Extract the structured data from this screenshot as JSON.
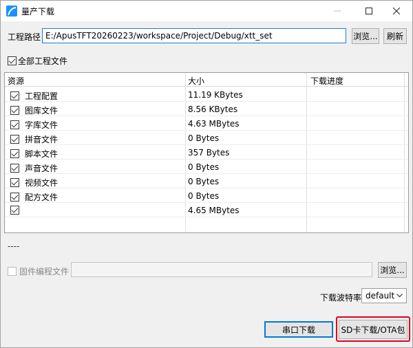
{
  "window": {
    "title": "量产下载",
    "icon": "app-logo-icon",
    "accent_color": "#1e90ff"
  },
  "project": {
    "label": "工程路径",
    "path": "E:/ApusTFT20260223/workspace/Project/Debug/xtt_set",
    "browse_label": "浏览...",
    "refresh_label": "刷新"
  },
  "all_files": {
    "label": "全部工程文件",
    "checked": true
  },
  "table": {
    "columns": [
      "资源",
      "大小",
      "下载进度"
    ],
    "rows": [
      {
        "name": "工程配置",
        "size": "11.19 KBytes",
        "checked": true
      },
      {
        "name": "图库文件",
        "size": "8.56 KBytes",
        "checked": true
      },
      {
        "name": "字库文件",
        "size": "4.63 MBytes",
        "checked": true
      },
      {
        "name": "拼音文件",
        "size": "0 Bytes",
        "checked": true
      },
      {
        "name": "脚本文件",
        "size": "357 Bytes",
        "checked": true
      },
      {
        "name": "声音文件",
        "size": "0 Bytes",
        "checked": true
      },
      {
        "name": "视频文件",
        "size": "0 Bytes",
        "checked": true
      },
      {
        "name": "配方文件",
        "size": "0 Bytes",
        "checked": true
      },
      {
        "name": "",
        "size": "4.65 MBytes",
        "checked": true
      }
    ]
  },
  "status_text": "----",
  "firmware": {
    "label": "固件编程文件",
    "checked": false,
    "path": "",
    "browse_label": "浏览..."
  },
  "baud": {
    "label": "下载波特率",
    "value": "default"
  },
  "actions": {
    "serial_label": "串口下载",
    "sd_label": "SD卡下载/OTA包",
    "highlight_color": "#e0001a"
  }
}
